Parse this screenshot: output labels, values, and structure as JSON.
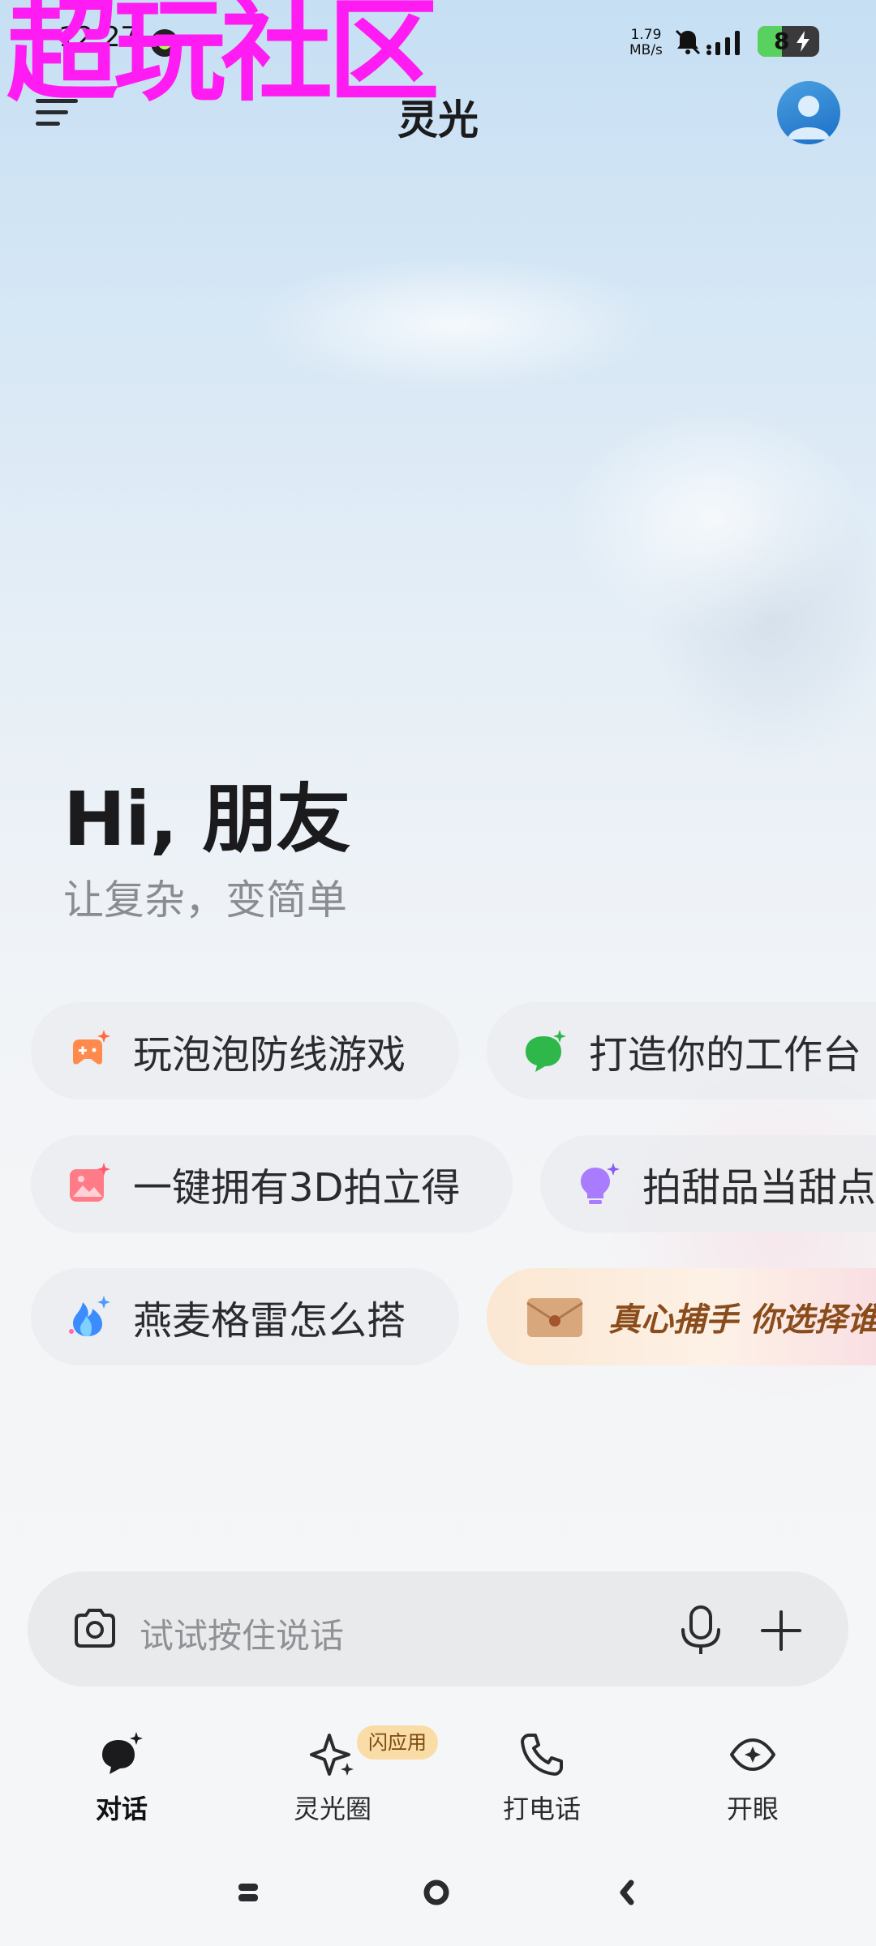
{
  "watermark": {
    "text": "超玩社区"
  },
  "status_bar": {
    "time": "12:27",
    "net_speed_value": "1.79",
    "net_speed_unit": "MB/s",
    "battery_level": "8"
  },
  "header": {
    "title": "灵光"
  },
  "greeting": {
    "title": "Hi, 朋友",
    "subtitle": "让复杂，变简单"
  },
  "suggestions": [
    {
      "label": "玩泡泡防线游戏",
      "icon": "gamepad-sparkle-icon"
    },
    {
      "label": "打造你的工作台",
      "icon": "chat-sparkle-icon"
    },
    {
      "label": "一键拥有3D拍立得",
      "icon": "image-sparkle-icon"
    },
    {
      "label": "拍甜品当甜点师",
      "icon": "lightbulb-sparkle-icon"
    },
    {
      "label": "燕麦格雷怎么搭",
      "icon": "flame-sparkle-icon"
    }
  ],
  "promo": {
    "label": "真心捕手 你选择谁",
    "icon": "envelope-icon"
  },
  "input": {
    "placeholder": "试试按住说话"
  },
  "bottom_nav": {
    "items": [
      {
        "label": "对话",
        "icon": "chat-bubble-sparkle-icon",
        "active": true
      },
      {
        "label": "灵光圈",
        "icon": "sparkle-star-icon",
        "badge": "闪应用"
      },
      {
        "label": "打电话",
        "icon": "phone-icon"
      },
      {
        "label": "开眼",
        "icon": "eye-sparkle-icon"
      }
    ]
  },
  "colors": {
    "watermark": "#ff1cf2",
    "chip_bg": "#ecedf0",
    "accent_green": "#2eb84a",
    "accent_orange": "#ff7a3d",
    "accent_purple": "#9b6bff",
    "accent_pink": "#ff6b7e",
    "badge_bg": "#f9dca6"
  }
}
